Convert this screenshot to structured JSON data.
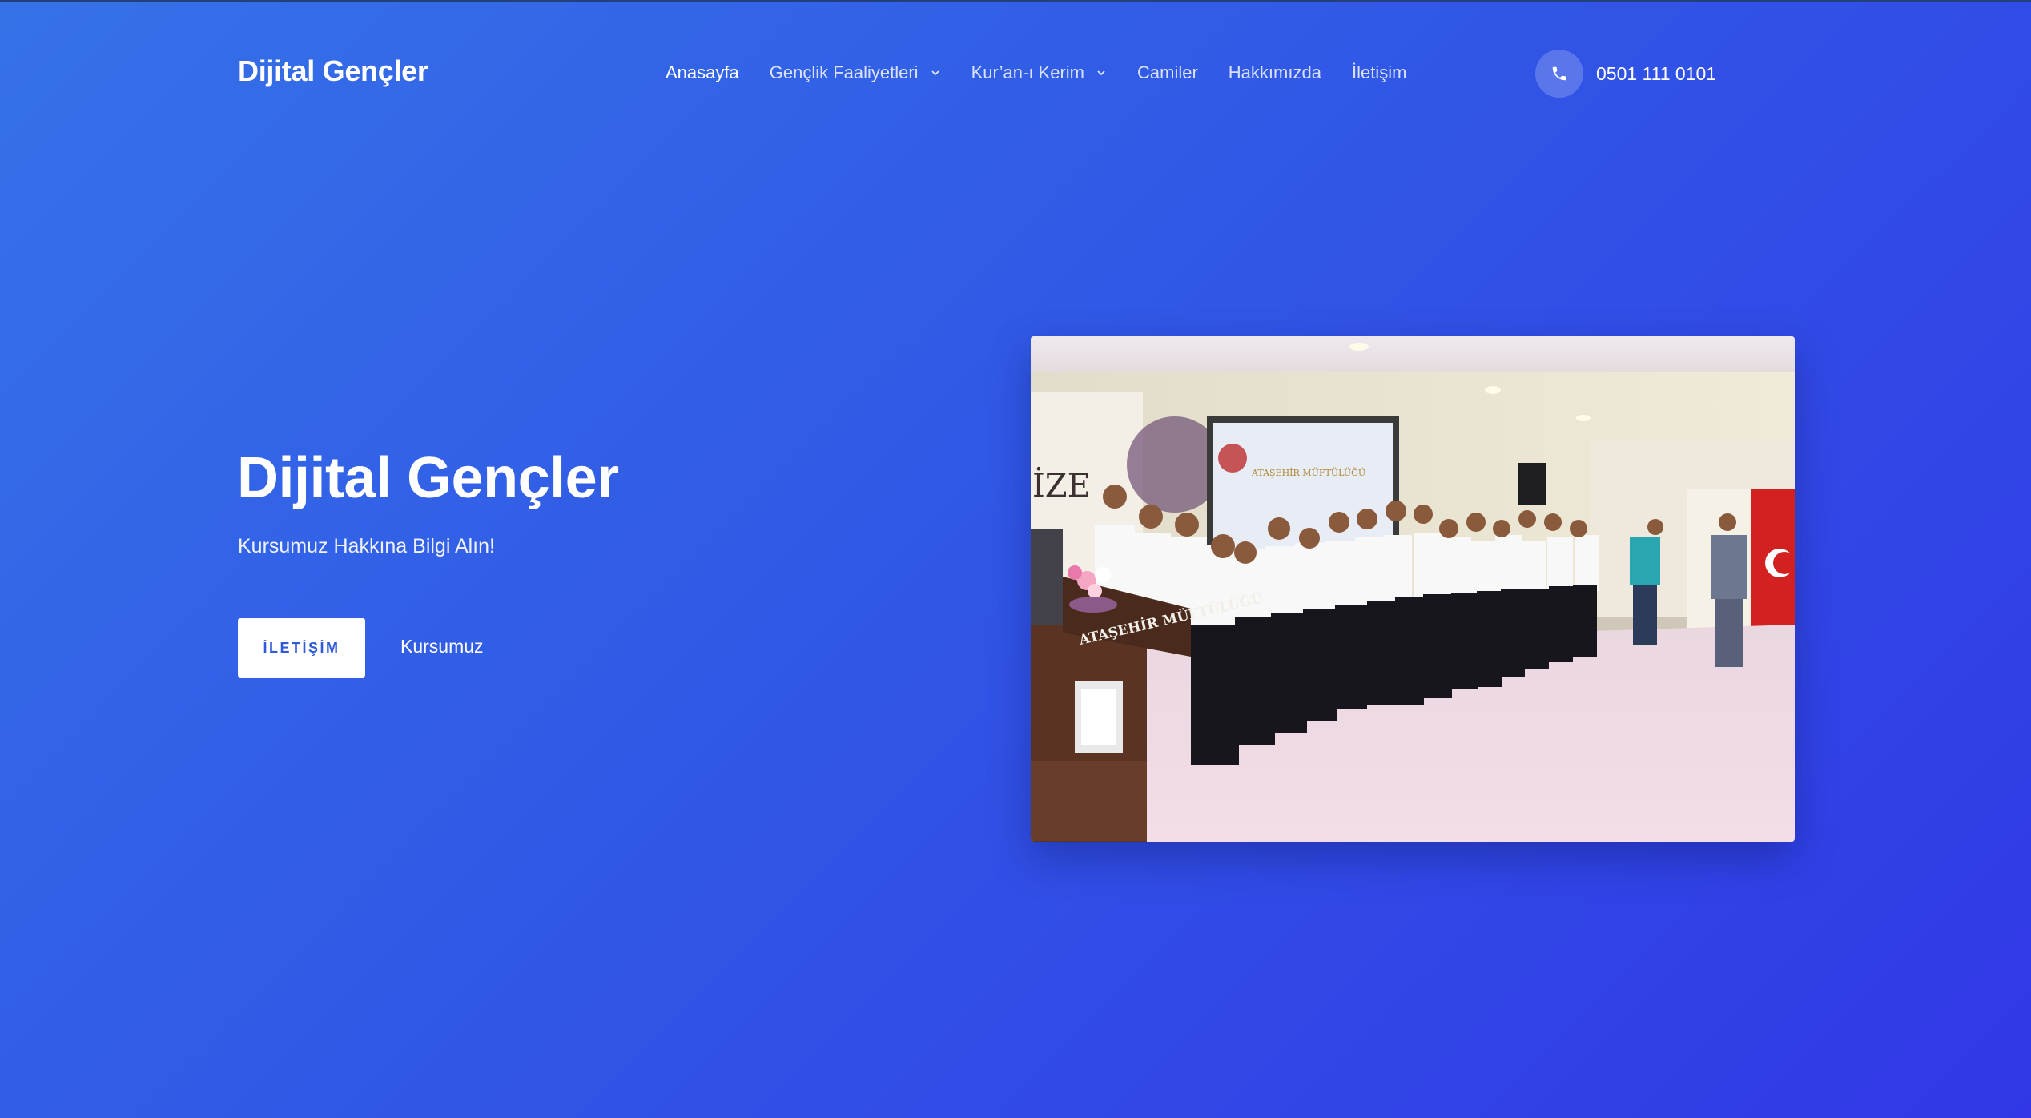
{
  "header": {
    "logo": "Dijital Gençler",
    "nav": [
      {
        "label": "Anasayfa",
        "active": true,
        "dropdown": false
      },
      {
        "label": "Gençlik Faaliyetleri",
        "active": false,
        "dropdown": true
      },
      {
        "label": "Kur’an-ı Kerim",
        "active": false,
        "dropdown": true
      },
      {
        "label": "Camiler",
        "active": false,
        "dropdown": false
      },
      {
        "label": "Hakkımızda",
        "active": false,
        "dropdown": false
      },
      {
        "label": "İletişim",
        "active": false,
        "dropdown": false
      }
    ],
    "phone": {
      "icon": "phone-icon",
      "number": "0501 111 0101"
    }
  },
  "hero": {
    "title": "Dijital Gençler",
    "subtitle": "Kursumuz Hakkına Bilgi Alın!",
    "primary_button": "İLETİŞİM",
    "secondary_link": "Kursumuz"
  },
  "photo": {
    "podium_text": "ATAŞEHİR MÜFTÜLÜĞÜ",
    "screen_text": "ATAŞEHİR MÜFTÜLÜĞÜ"
  },
  "colors": {
    "background_start": "#3572e8",
    "background_end": "#3137e6",
    "button_text": "#2f5bd8"
  }
}
